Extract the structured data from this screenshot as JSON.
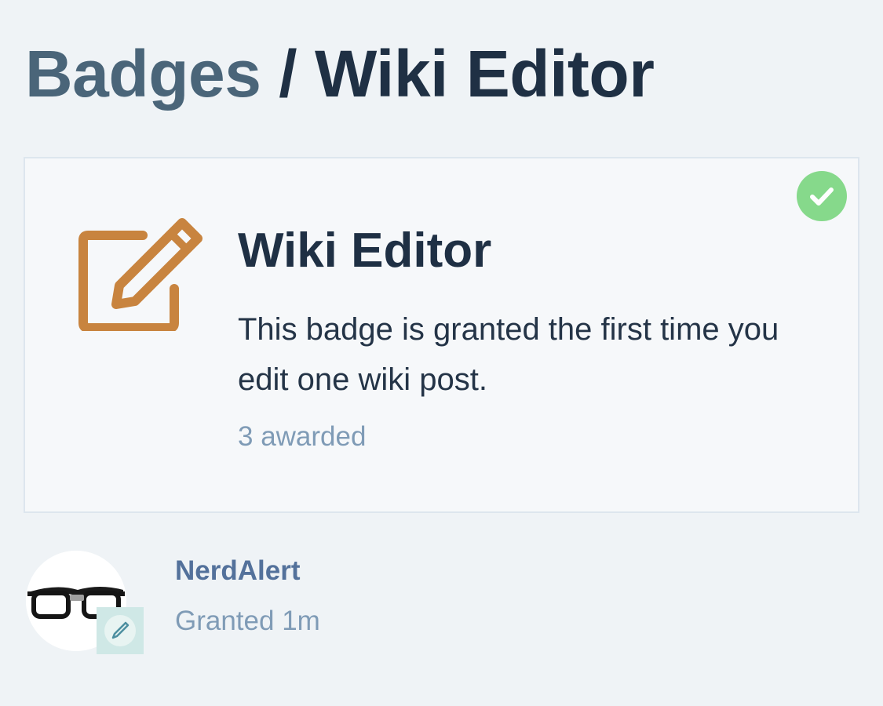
{
  "header": {
    "breadcrumb_parent": "Badges",
    "separator": " / ",
    "current": "Wiki Editor"
  },
  "badge": {
    "name": "Wiki Editor",
    "description": "This badge is granted the first time you edit one wiki post.",
    "awarded_count": "3 awarded",
    "icon": "pencil-square-icon",
    "icon_color": "#c8843f",
    "granted_status_icon": "check-circle-icon",
    "granted_status_color": "#86d98b"
  },
  "grants": [
    {
      "username": "NerdAlert",
      "granted_text": "Granted 1m",
      "avatar_icon": "glasses-avatar",
      "mini_badge_icon": "pencil-icon"
    }
  ],
  "colors": {
    "background": "#eff3f6",
    "card_background": "#f6f8fa",
    "title_link": "#4a6579",
    "title_text": "#1f3044",
    "muted_text": "#7f9bb6",
    "username_link": "#53719b"
  }
}
